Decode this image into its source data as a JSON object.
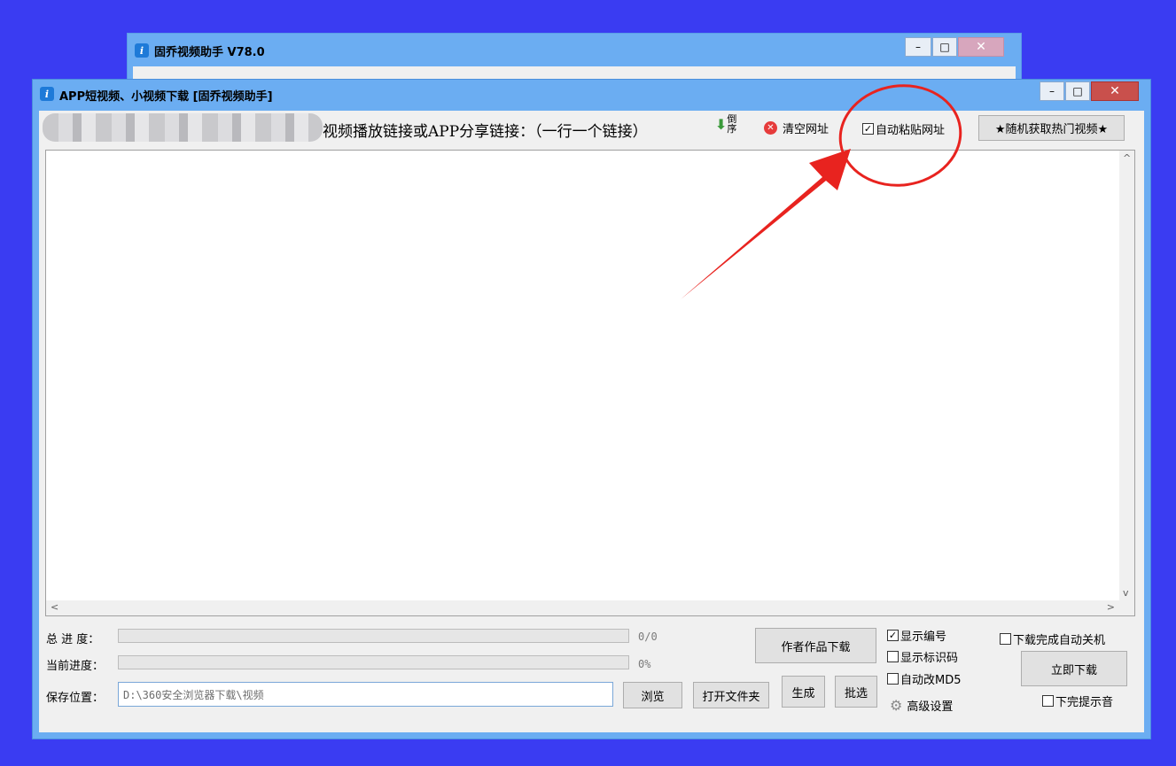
{
  "background_window": {
    "title": "固乔视频助手 V78.0",
    "icon": "app-icon",
    "icon_glyph": "i",
    "controls": {
      "minimize": "–",
      "maximize": "□",
      "close": "✕"
    }
  },
  "main_window": {
    "title": "APP短视频、小视频下载 [固乔视频助手]",
    "icon": "app-icon",
    "icon_glyph": "i",
    "controls": {
      "minimize": "–",
      "maximize": "□",
      "close": "✕"
    }
  },
  "toolbar": {
    "prompt_label": "视频播放链接或APP分享链接：（一行一个链接）",
    "reverse_label": "倒序",
    "reverse_icon": "⬇",
    "clear_icon_glyph": "✕",
    "clear_label": "清空网址",
    "auto_paste": {
      "label": "自动粘贴网址",
      "checked": true,
      "mark": "✓"
    },
    "random_hot_button": "★随机获取热门视频★"
  },
  "link_input": {
    "value": "",
    "scroll_up": "^",
    "scroll_down": "v",
    "scroll_left": "<",
    "scroll_right": ">"
  },
  "progress": {
    "total_label": "总 进 度：",
    "total_text": "0/0",
    "total_fraction": 0,
    "current_label": "当前进度：",
    "current_text": "0%",
    "current_fraction": 0
  },
  "save": {
    "label": "保存位置：",
    "path": "D:\\360安全浏览器下载\\视频",
    "browse_button": "浏览",
    "open_folder_button": "打开文件夹"
  },
  "actions": {
    "author_download_button": "作者作品下载",
    "generate_button": "生成",
    "filter_button": "批选",
    "download_now_button": "立即下载"
  },
  "options": {
    "show_number": {
      "label": "显示编号",
      "checked": true
    },
    "show_id_code": {
      "label": "显示标识码",
      "checked": false
    },
    "auto_md5": {
      "label": "自动改MD5",
      "checked": false
    },
    "advanced_settings": "高级设置",
    "shutdown_after": {
      "label": "下载完成自动关机",
      "checked": false
    },
    "done_sound": {
      "label": "下完提示音",
      "checked": false
    },
    "check_mark": "✓",
    "gear_glyph": "⚙"
  },
  "colors": {
    "desktop": "#3a3cf2",
    "titlebar": "#6badf2",
    "annotation_red": "#e8231f",
    "close_red": "#c9504c"
  }
}
